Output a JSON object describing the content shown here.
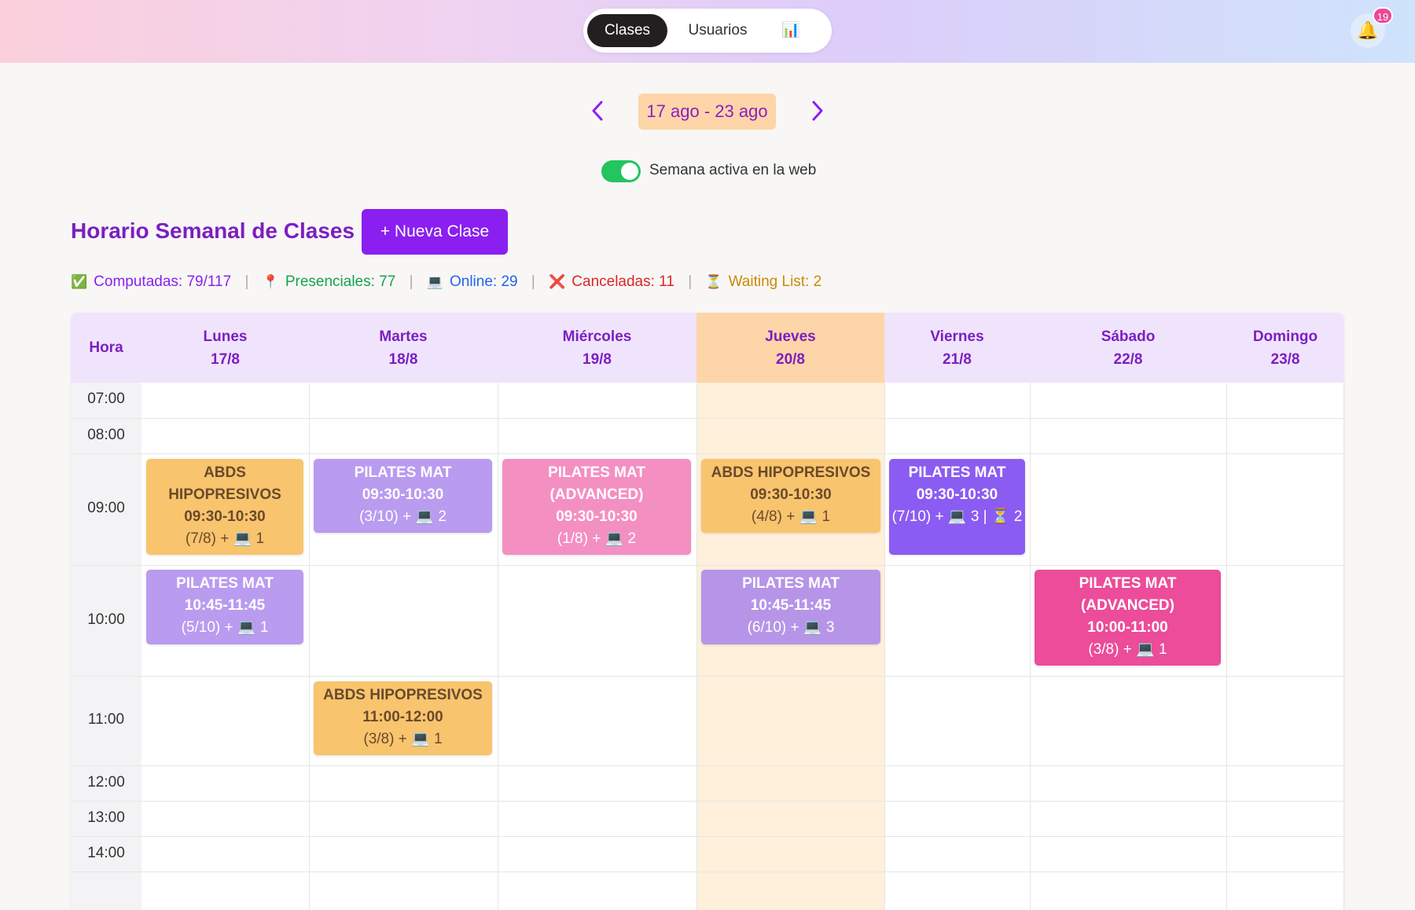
{
  "nav": {
    "tabs": [
      "Clases",
      "Usuarios"
    ],
    "stats_icon": "📊",
    "notifications": "19"
  },
  "week": {
    "label": "17 ago - 23 ago",
    "toggle_label": "Semana activa en la web",
    "toggle_on": true
  },
  "header": {
    "title": "Horario Semanal de Clases",
    "new_button": "+ Nueva Clase"
  },
  "stats": {
    "computadas": "Computadas: 79/117",
    "presenciales": "Presenciales: 77",
    "online": "Online: 29",
    "canceladas": "Canceladas: 11",
    "waiting": "Waiting List: 2"
  },
  "colors": {
    "accent": "#8a1ff0",
    "title": "#7b1fc2",
    "today": "#fdd5a8",
    "presenciales": "#16a34a",
    "online": "#2563eb",
    "canceladas": "#dc2626",
    "waiting": "#ca8a04"
  },
  "calendar": {
    "hour_header": "Hora",
    "days": [
      {
        "name": "Lunes",
        "date": "17/8"
      },
      {
        "name": "Martes",
        "date": "18/8"
      },
      {
        "name": "Miércoles",
        "date": "19/8"
      },
      {
        "name": "Jueves",
        "date": "20/8"
      },
      {
        "name": "Viernes",
        "date": "21/8"
      },
      {
        "name": "Sábado",
        "date": "22/8"
      },
      {
        "name": "Domingo",
        "date": "23/8"
      }
    ],
    "hours": [
      "07:00",
      "08:00",
      "09:00",
      "10:00",
      "11:00",
      "12:00",
      "13:00",
      "14:00"
    ],
    "events": [
      {
        "name": "ABDS HIPOPRESIVOS",
        "time": "09:30-10:30",
        "meta": "(7/8) + 💻 1"
      },
      {
        "name": "PILATES MAT",
        "time": "09:30-10:30",
        "meta": "(3/10) + 💻 2"
      },
      {
        "name": "PILATES MAT (ADVANCED)",
        "time": "09:30-10:30",
        "meta": "(1/8) + 💻 2"
      },
      {
        "name": "ABDS HIPOPRESIVOS",
        "time": "09:30-10:30",
        "meta": "(4/8) + 💻 1"
      },
      {
        "name": "PILATES MAT",
        "time": "09:30-10:30",
        "meta": "(7/10) + 💻 3 | ⏳ 2"
      },
      {
        "name": "PILATES MAT",
        "time": "10:45-11:45",
        "meta": "(5/10) + 💻 1"
      },
      {
        "name": "PILATES MAT",
        "time": "10:45-11:45",
        "meta": "(6/10) + 💻 3"
      },
      {
        "name": "PILATES MAT (ADVANCED)",
        "time": "10:00-11:00",
        "meta": "(3/8) + 💻 1"
      },
      {
        "name": "ABDS HIPOPRESIVOS",
        "time": "11:00-12:00",
        "meta": "(3/8) + 💻 1"
      }
    ]
  }
}
